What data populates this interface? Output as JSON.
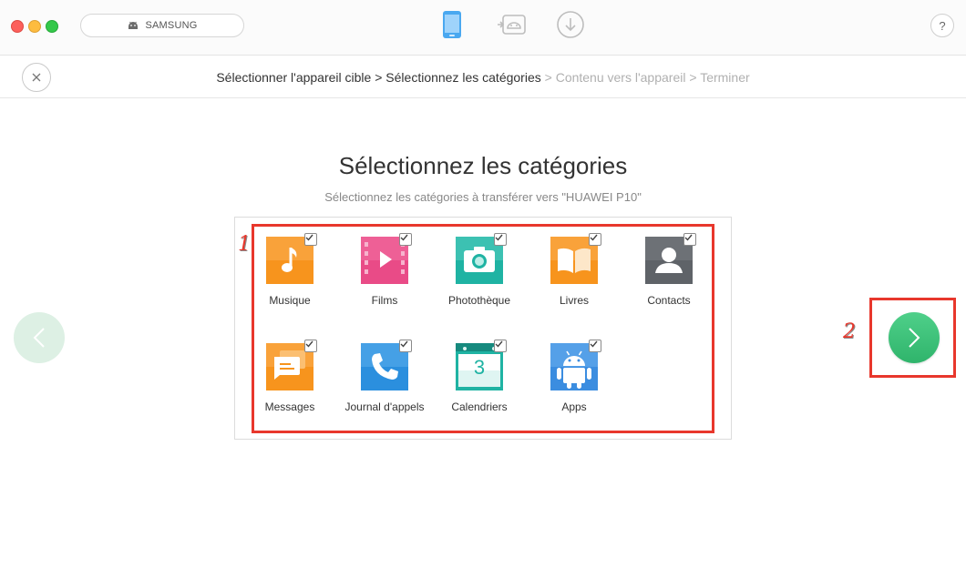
{
  "titlebar": {
    "device_name": "SAMSUNG"
  },
  "toolbar": {
    "help_label": "?"
  },
  "breadcrumb": {
    "steps": [
      {
        "label": "Sélectionner l'appareil cible",
        "active": true
      },
      {
        "label": "Sélectionnez les catégories",
        "active": true
      },
      {
        "label": "Contenu vers l'appareil",
        "active": false
      },
      {
        "label": "Terminer",
        "active": false
      }
    ],
    "separator": ">"
  },
  "main": {
    "title": "Sélectionnez les catégories",
    "subtitle": "Sélectionnez les catégories à transférer vers \"HUAWEI P10\""
  },
  "categories": [
    {
      "label": "Musique",
      "icon": "music-icon",
      "checked": true
    },
    {
      "label": "Films",
      "icon": "film-icon",
      "checked": true
    },
    {
      "label": "Photothèque",
      "icon": "camera-icon",
      "checked": true
    },
    {
      "label": "Livres",
      "icon": "book-icon",
      "checked": true
    },
    {
      "label": "Contacts",
      "icon": "contact-icon",
      "checked": true
    },
    {
      "label": "Messages",
      "icon": "message-icon",
      "checked": true
    },
    {
      "label": "Journal d'appels",
      "icon": "phone-call-icon",
      "checked": true
    },
    {
      "label": "Calendriers",
      "icon": "calendar-icon",
      "checked": true
    },
    {
      "label": "Apps",
      "icon": "android-app-icon",
      "checked": true
    }
  ],
  "calendar_day": "3",
  "annotations": {
    "marker_1": "1",
    "marker_2": "2"
  },
  "colors": {
    "accent_green": "#3cc27a",
    "annotation_red": "#e8372c",
    "music": "#f7941d",
    "films": "#e94b87",
    "photos": "#1fb3a3",
    "books": "#f7941d",
    "contacts": "#5f6368",
    "messages": "#f7941d",
    "calls": "#2b8fde",
    "calendar": "#1fb3a3",
    "apps": "#3b8de0"
  }
}
